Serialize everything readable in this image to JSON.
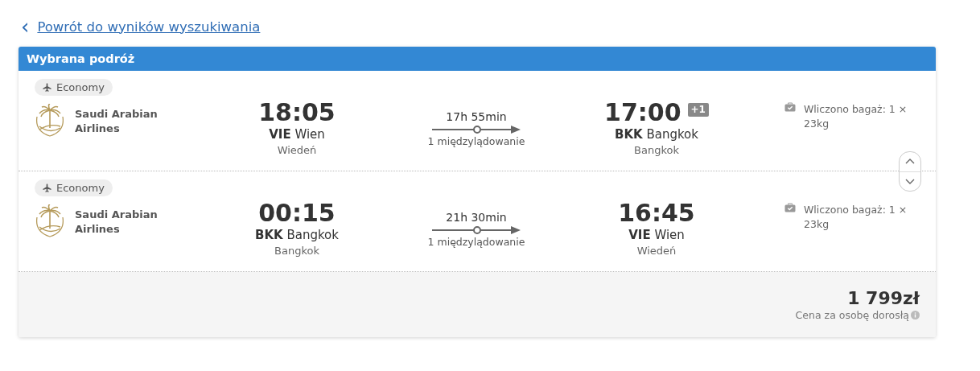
{
  "back_link": {
    "icon": "‹",
    "label": "Powrót do wyników wyszukiwania"
  },
  "trip": {
    "title": "Wybrana podróż",
    "segments": [
      {
        "cabin": "Economy",
        "airline": "Saudi Arabian Airlines",
        "departure": {
          "time": "18:05",
          "code": "VIE",
          "city": "Wien",
          "city_local": "Wiedeń"
        },
        "duration": "17h 55min",
        "stops": "1 międzylądowanie",
        "arrival": {
          "time": "17:00",
          "day_offset": "+1",
          "code": "BKK",
          "city": "Bangkok",
          "city_local": "Bangkok"
        },
        "baggage": "Wliczono bagaż: 1 × 23kg"
      },
      {
        "cabin": "Economy",
        "airline": "Saudi Arabian Airlines",
        "departure": {
          "time": "00:15",
          "code": "BKK",
          "city": "Bangkok",
          "city_local": "Bangkok"
        },
        "duration": "21h 30min",
        "stops": "1 międzylądowanie",
        "arrival": {
          "time": "16:45",
          "code": "VIE",
          "city": "Wien",
          "city_local": "Wiedeń"
        },
        "baggage": "Wliczono bagaż: 1 × 23kg"
      }
    ],
    "price": "1 799zł",
    "price_note": "Cena za osobę dorosłą"
  }
}
